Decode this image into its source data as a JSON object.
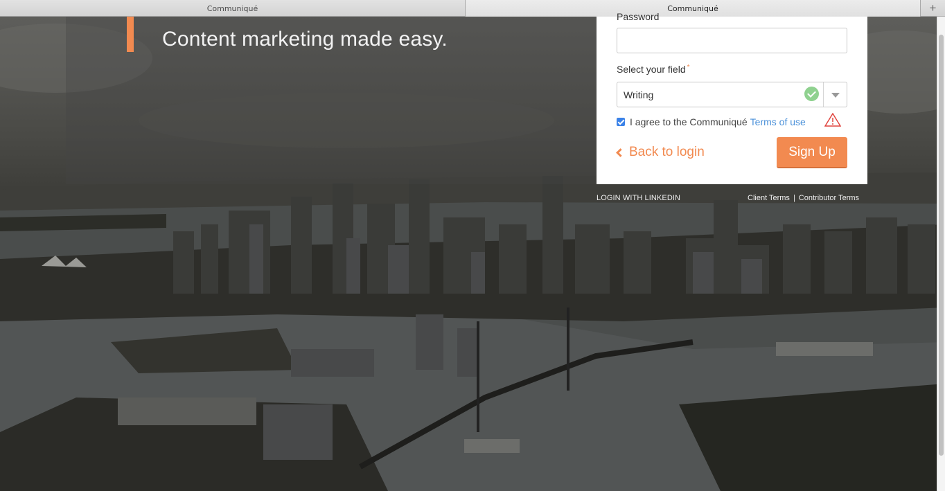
{
  "tabs": [
    {
      "label": "Communiqué"
    },
    {
      "label": "Communiqué"
    }
  ],
  "tab_add_label": "+",
  "hero": {
    "tagline": "Content marketing made easy."
  },
  "form": {
    "password_label": "Password",
    "password_value": "",
    "field_label": "Select your field",
    "required_marker": "*",
    "field_value": "Writing",
    "agree_text": "I agree to the Communiqué",
    "terms_link": "Terms of use",
    "agree_checked": true,
    "back_label": "Back to login",
    "signup_label": "Sign Up"
  },
  "footer": {
    "linkedin": "LOGIN WITH LINKEDIN",
    "client_terms": "Client Terms",
    "separator": "|",
    "contributor_terms": "Contributor Terms"
  },
  "colors": {
    "accent": "#f28a50",
    "link": "#4a90d9",
    "valid": "#8fd18f",
    "checkbox": "#3b82e8",
    "warning": "#e0443e"
  },
  "icons": [
    "check-circle-icon",
    "chevron-down-icon",
    "checkbox-icon",
    "warning-triangle-icon",
    "chevron-left-icon",
    "plus-icon"
  ]
}
